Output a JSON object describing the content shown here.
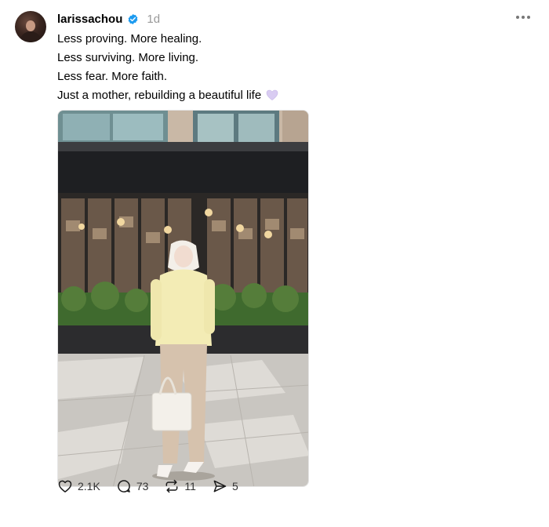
{
  "post": {
    "username": "larissachou",
    "timestamp": "1d",
    "caption_lines": [
      "Less proving. More healing.",
      "Less surviving. More living.",
      "Less fear. More faith.",
      "Just a mother, rebuilding a beautiful life"
    ],
    "emoji": "white-heart-icon"
  },
  "actions": {
    "likes": "2.1K",
    "comments": "73",
    "reposts": "11",
    "shares": "5"
  },
  "colors": {
    "verified": "#1d9bf0",
    "muted": "#999999",
    "emoji": "#d9ccf2"
  }
}
